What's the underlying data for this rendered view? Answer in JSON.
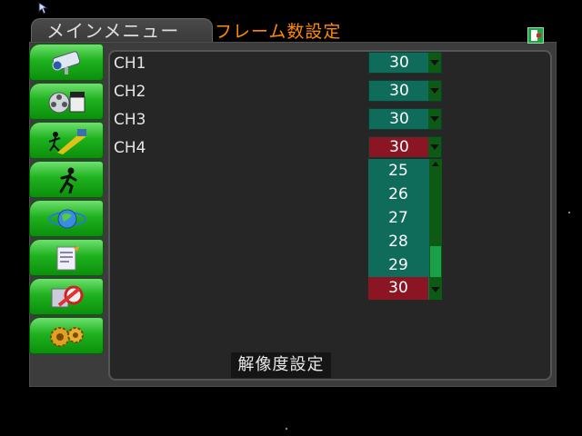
{
  "header": {
    "main_tab": "メインメニュー",
    "section_title": "フレーム数設定"
  },
  "channels": [
    {
      "label": "CH1",
      "value": "30"
    },
    {
      "label": "CH2",
      "value": "30"
    },
    {
      "label": "CH3",
      "value": "30"
    },
    {
      "label": "CH4",
      "value": "30"
    }
  ],
  "dropdown": {
    "options": [
      "25",
      "26",
      "27",
      "28",
      "29",
      "30"
    ],
    "selected": "30"
  },
  "footer": {
    "resolution_button": "解像度設定"
  },
  "sidebar": {
    "icons": [
      "camera-icon",
      "film-icon",
      "motion-detect-icon",
      "running-person-icon",
      "network-globe-icon",
      "document-icon",
      "tools-icon",
      "gears-icon"
    ]
  },
  "colors": {
    "title_orange": "#ff8a00",
    "value_teal": "#0f6b5a",
    "active_red": "#8b1523",
    "sidebar_green": "#1fb21f"
  }
}
